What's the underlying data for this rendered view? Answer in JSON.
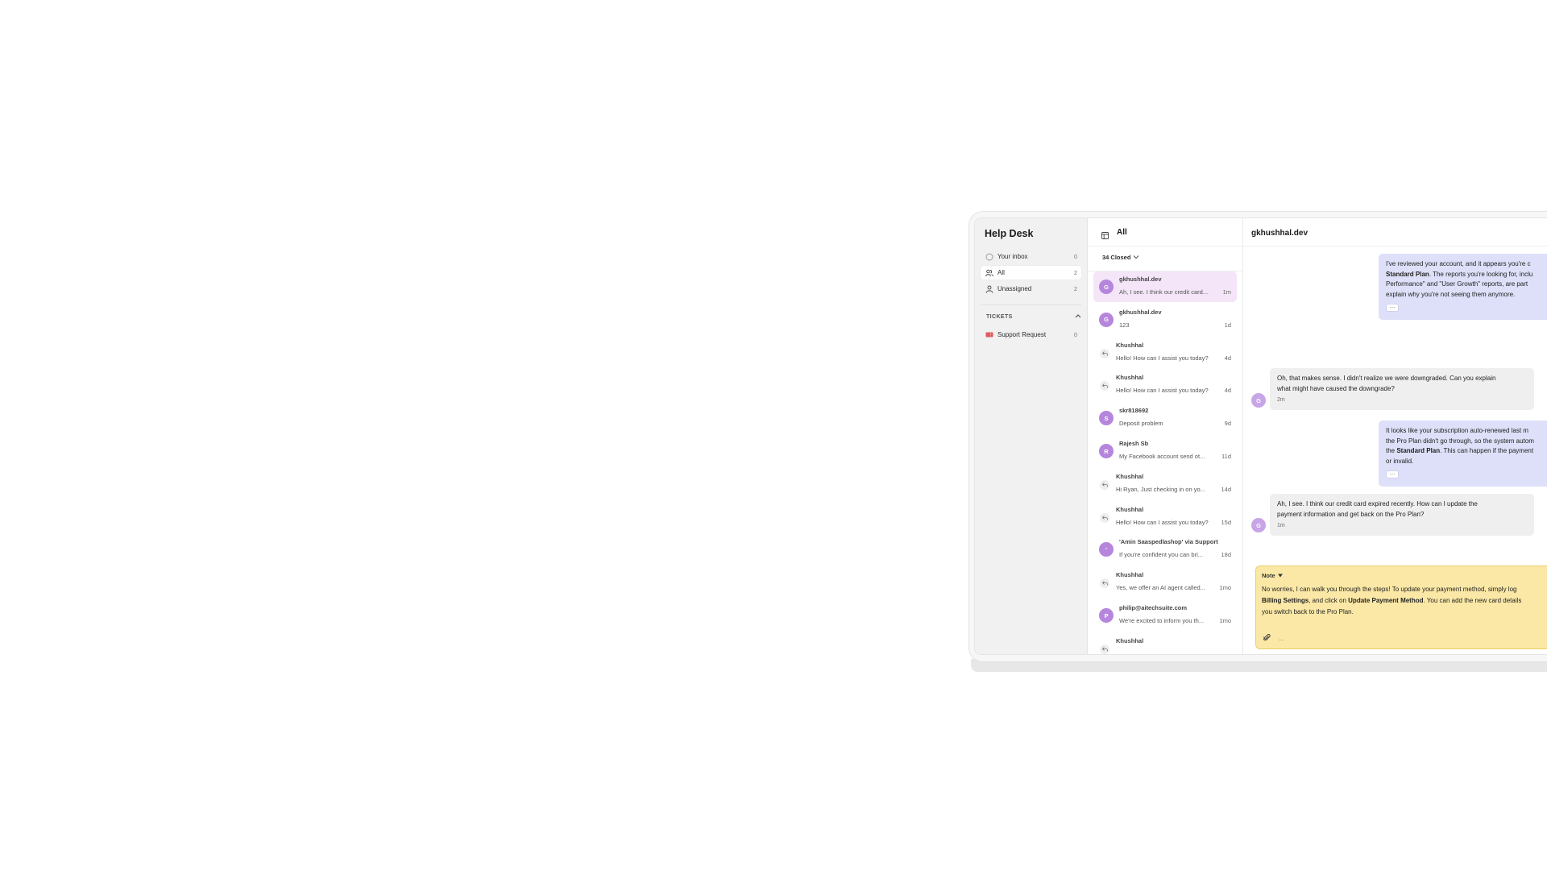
{
  "app": {
    "title": "Help Desk"
  },
  "sidebar": {
    "items": [
      {
        "label": "Your inbox",
        "count": "0"
      },
      {
        "label": "All",
        "count": "2"
      },
      {
        "label": "Unassigned",
        "count": "2"
      }
    ],
    "tickets_heading": "TICKETS",
    "tickets": [
      {
        "label": "Support Request",
        "count": "0"
      }
    ]
  },
  "list": {
    "title": "All",
    "filter_label": "34 Closed",
    "conversations": [
      {
        "initial": "G",
        "name": "gkhushhal.dev",
        "preview": "Ah, I see. I think our credit card...",
        "time": "1m",
        "kind": "avatar"
      },
      {
        "initial": "G",
        "name": "gkhushhal.dev",
        "preview": "123",
        "time": "1d",
        "kind": "avatar"
      },
      {
        "initial": "",
        "name": "Khushhal",
        "preview": "Hello! How can I assist you today?",
        "time": "4d",
        "kind": "reply"
      },
      {
        "initial": "",
        "name": "Khushhal",
        "preview": "Hello! How can I assist you today?",
        "time": "4d",
        "kind": "reply"
      },
      {
        "initial": "S",
        "name": "skr818692",
        "preview": "Deposit problem",
        "time": "9d",
        "kind": "avatar"
      },
      {
        "initial": "R",
        "name": "Rajesh Sb",
        "preview": "My Facebook account send ot...",
        "time": "11d",
        "kind": "avatar"
      },
      {
        "initial": "",
        "name": "Khushhal",
        "preview": "Hi Ryan, Just checking in on yo...",
        "time": "14d",
        "kind": "reply"
      },
      {
        "initial": "",
        "name": "Khushhal",
        "preview": "Hello! How can I assist you today?",
        "time": "15d",
        "kind": "reply"
      },
      {
        "initial": "'",
        "name": "'Amin Saaspedlashop' via Support",
        "preview": "If you're confident you can bri...",
        "time": "18d",
        "kind": "avatar"
      },
      {
        "initial": "",
        "name": "Khushhal",
        "preview": "Yes, we offer an AI agent called...",
        "time": "1mo",
        "kind": "reply"
      },
      {
        "initial": "P",
        "name": "philip@aitechsuite.com",
        "preview": "We're excited to inform you th...",
        "time": "1mo",
        "kind": "avatar"
      },
      {
        "initial": "",
        "name": "Khushhal",
        "preview": "",
        "time": "",
        "kind": "reply"
      }
    ]
  },
  "chat": {
    "title": "gkhushhal.dev",
    "msg1": {
      "l1": "I've reviewed your account, and it appears you're c",
      "l2a": "Standard Plan",
      "l2b": ". The reports you're looking for, inclu",
      "l3": "Performance\" and \"User Growth\" reports, are part",
      "l4": "explain why you're not seeing them anymore."
    },
    "msg2": {
      "l1": "Oh, that makes sense. I didn't realize we were downgraded. Can you explain",
      "l2": "what might have caused the downgrade?",
      "time": "2m",
      "initial": "G"
    },
    "msg3": {
      "l1": "It looks like your subscription auto-renewed last m",
      "l2": "the Pro Plan didn't go through, so the system autom",
      "l3a": "the ",
      "l3b": "Standard Plan",
      "l3c": ". This can happen if the payment",
      "l4": "or invalid."
    },
    "msg4": {
      "l1": "Ah, I see. I think our credit card expired recently. How can I update the",
      "l2": "payment information and get back on the Pro Plan?",
      "time": "1m",
      "initial": "G"
    },
    "more_label": "...",
    "note": {
      "label": "Note",
      "l1": "No worries, I can walk you through the steps! To update your payment method, simply log",
      "l2a": "Billing Settings",
      "l2b": ", and click on ",
      "l2c": "Update Payment Method",
      "l2d": ". You can add the new card details",
      "l3": "you switch back to the Pro Plan.",
      "tools_more": "..."
    }
  },
  "colors": {
    "accent": "#b586dc",
    "agent_bubble": "#dde0f8",
    "note_bg": "#fbe8a6",
    "selected_row": "#f4e5f8"
  }
}
